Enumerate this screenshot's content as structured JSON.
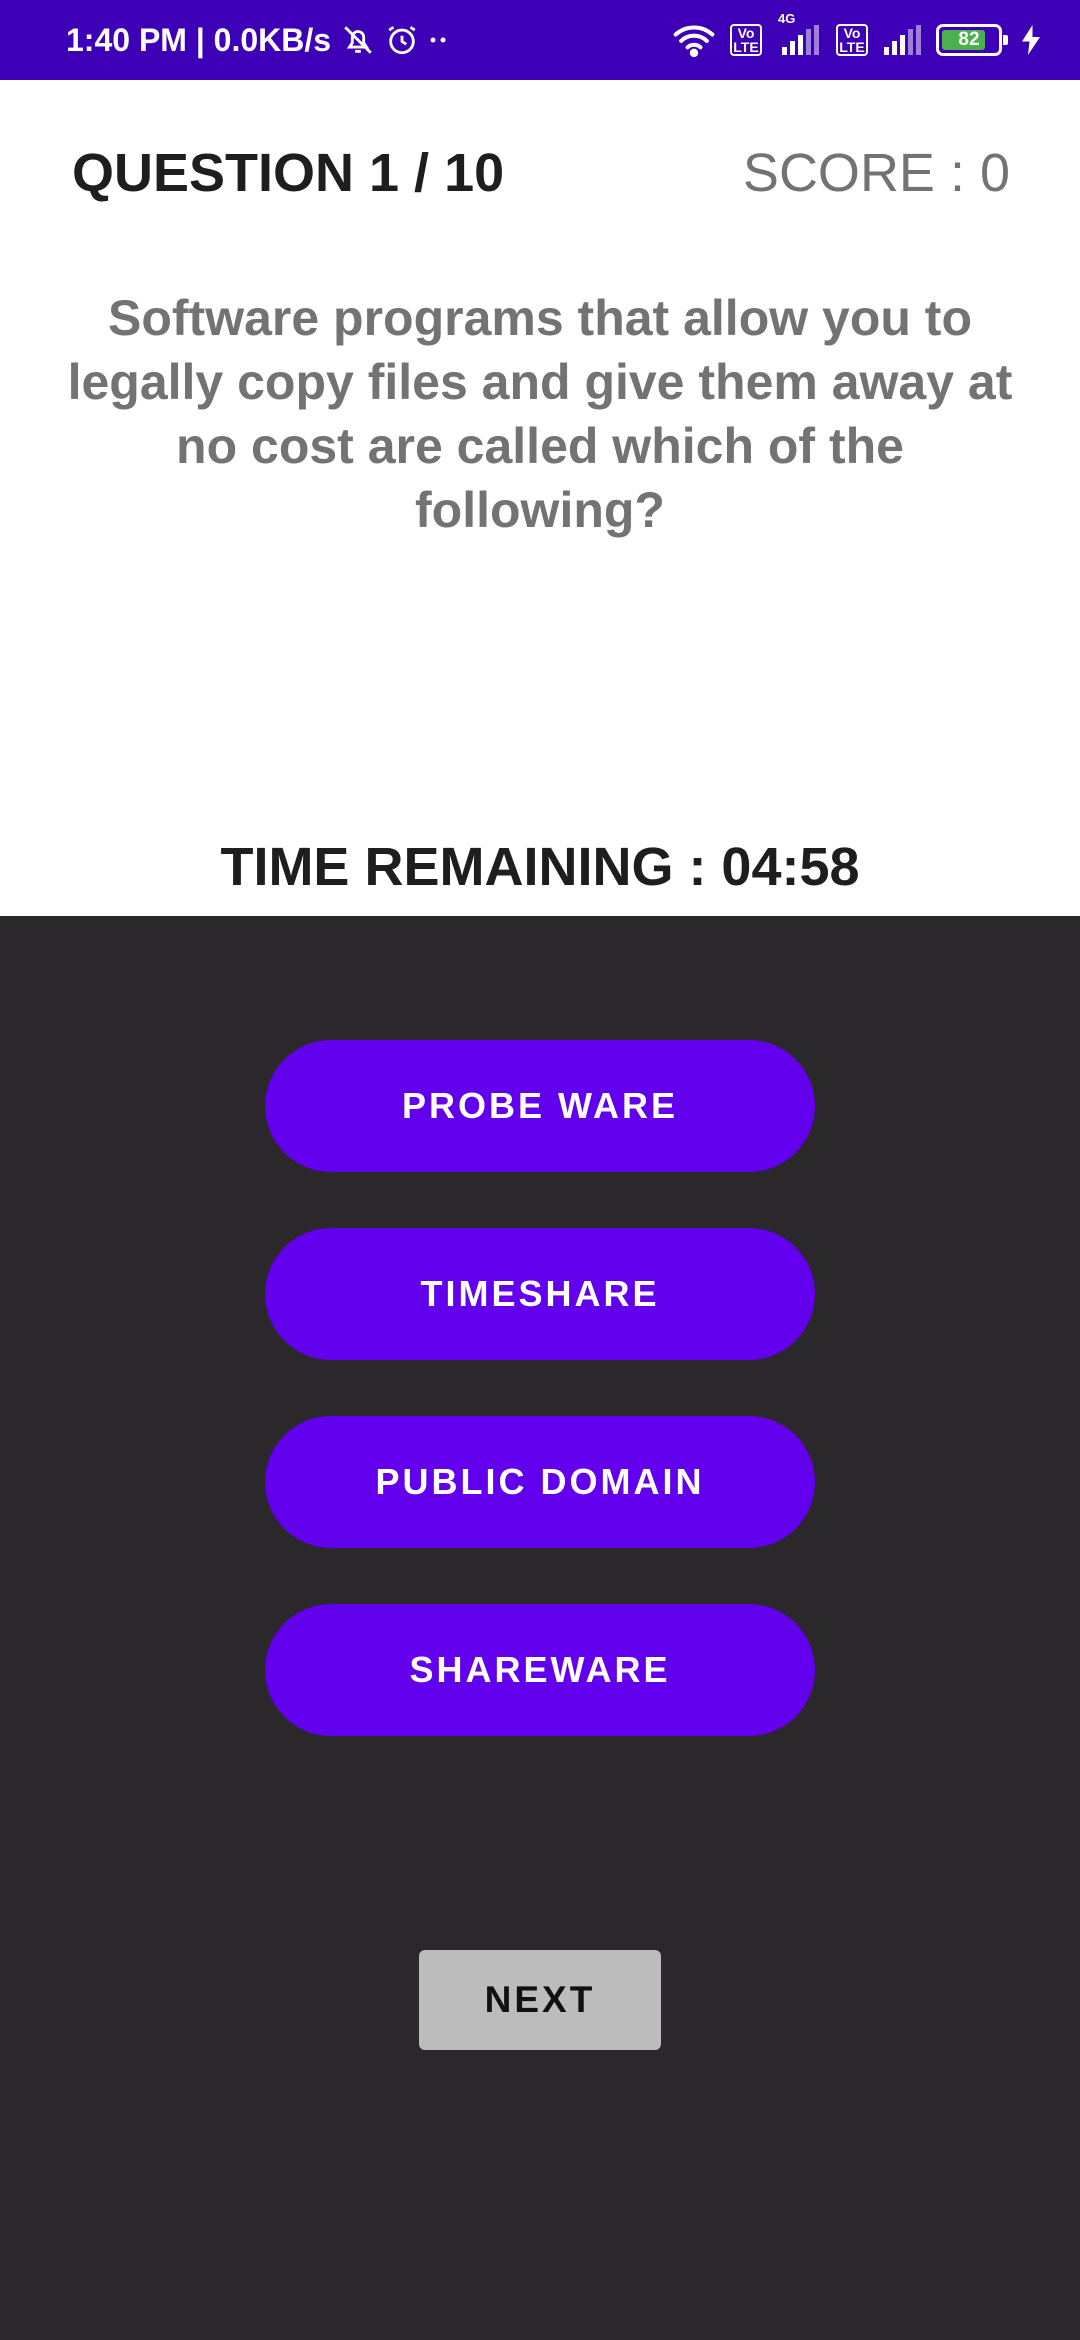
{
  "status_bar": {
    "time_speed": "1:40 PM | 0.0KB/s",
    "network_label": "4G",
    "volte_label_top": "Vo",
    "volte_label_bottom": "LTE",
    "battery_level": "82",
    "icons": [
      "mute-icon",
      "alarm-icon",
      "more-dots-icon",
      "wifi-icon",
      "volte-icon",
      "signal-icon",
      "battery-icon",
      "charging-icon"
    ]
  },
  "quiz": {
    "question_counter": "QUESTION 1 / 10",
    "score": "SCORE : 0",
    "question_text": "Software programs that allow you to legally copy files and give them away at no cost are called which of the following?",
    "time_remaining": "TIME REMAINING : 04:58"
  },
  "options": [
    {
      "label": "PROBE WARE"
    },
    {
      "label": "TIMESHARE"
    },
    {
      "label": "PUBLIC DOMAIN"
    },
    {
      "label": "SHAREWARE"
    }
  ],
  "next_label": "NEXT",
  "colors": {
    "status_bar": "#3d00b7",
    "option_button": "#6200ee",
    "bottom_panel": "#2a282b",
    "next_button": "#bcbcbc"
  }
}
